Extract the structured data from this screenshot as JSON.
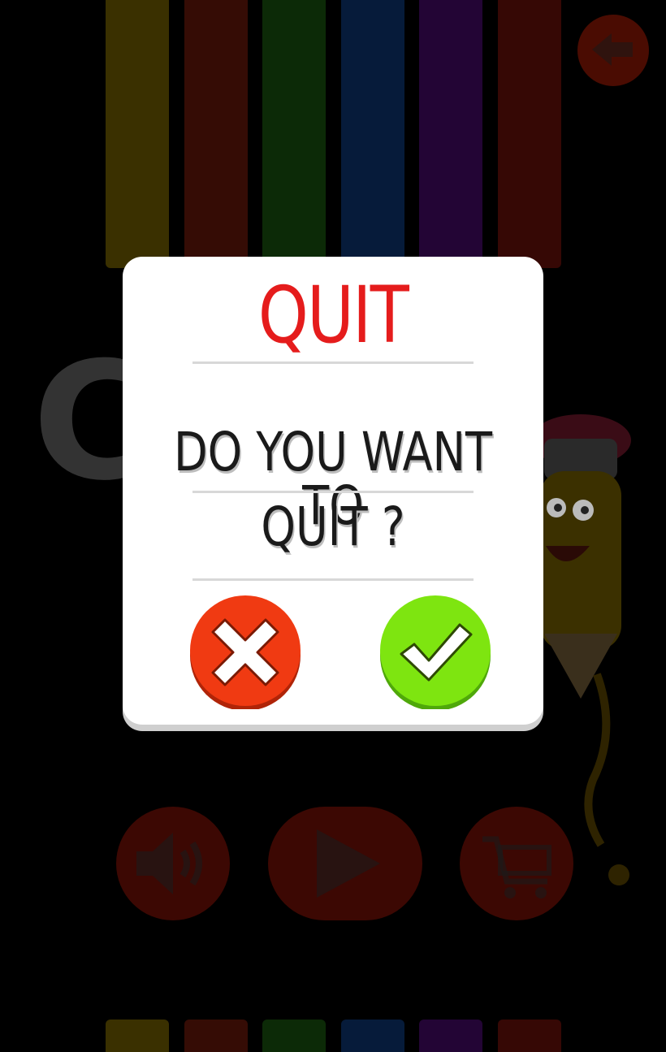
{
  "background": {
    "bar_colors": [
      "#3a3000",
      "#350c05",
      "#0c2a07",
      "#061b3a",
      "#230535",
      "#360805"
    ],
    "back_button_icon": "back-arrow-icon",
    "big_letter": "C",
    "sound_icon": "speaker-icon",
    "play_icon": "play-icon",
    "cart_icon": "cart-icon"
  },
  "dialog": {
    "title": "QUIT",
    "message_line1": "DO YOU WANT TO",
    "message_line2": "QUIT ?",
    "cancel_icon": "close-x-icon",
    "confirm_icon": "checkmark-icon",
    "title_color": "#e51c1c",
    "cancel_color": "#f03a12",
    "confirm_color": "#7ee510"
  }
}
